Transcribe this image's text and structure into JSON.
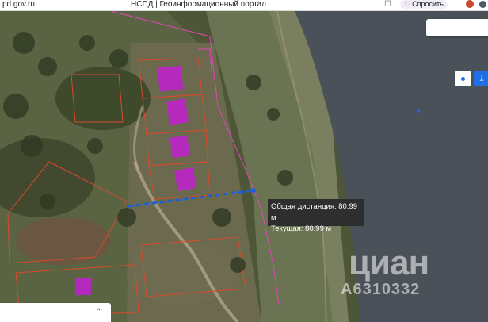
{
  "browser": {
    "url": "pd.gov.ru",
    "title": "НСПД | Геоинформационный портал",
    "ask_label": "Спросить",
    "bookmark_icon": "bookmark-icon",
    "ask_icon": "heart-ask-icon"
  },
  "map": {
    "tooltip": {
      "total_distance": "Общая дистанция: 80.99 м",
      "current_distance": "Текущая: 80.99 м"
    },
    "watermark": {
      "logo": "циан",
      "code": "A6310332"
    },
    "colors": {
      "parcel_fill": "#c21fd0",
      "parcel_border": "#d94a2c",
      "measure_line": "#1d5fd8",
      "water": "#4b5158"
    }
  },
  "tools": {
    "search_placeholder": "",
    "locate_icon": "locate-icon",
    "download_icon": "download-icon"
  },
  "bottom_select": {
    "value": "",
    "arrow_icon": "updown-chevron-icon"
  }
}
